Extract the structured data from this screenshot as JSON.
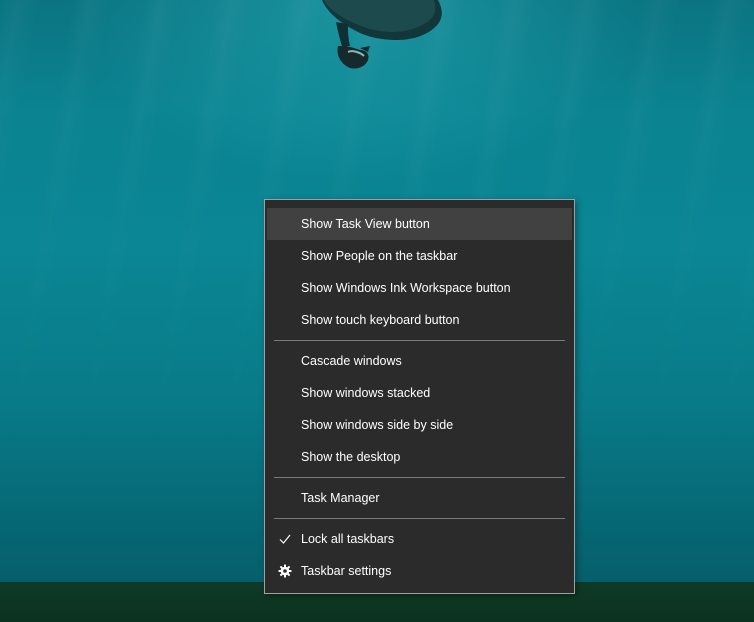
{
  "desktop": {
    "wallpaper": "underwater-swimmer",
    "water_color": "#0a8694",
    "taskbar_color": "#0e3b26"
  },
  "context_menu": {
    "background": "#2b2b2b",
    "highlight": "#414141",
    "groups": [
      {
        "items": [
          {
            "label": "Show Task View button",
            "highlighted": true
          },
          {
            "label": "Show People on the taskbar"
          },
          {
            "label": "Show Windows Ink Workspace button"
          },
          {
            "label": "Show touch keyboard button"
          }
        ]
      },
      {
        "items": [
          {
            "label": "Cascade windows"
          },
          {
            "label": "Show windows stacked"
          },
          {
            "label": "Show windows side by side"
          },
          {
            "label": "Show the desktop"
          }
        ]
      },
      {
        "items": [
          {
            "label": "Task Manager"
          }
        ]
      },
      {
        "items": [
          {
            "label": "Lock all taskbars",
            "icon": "checkmark-icon",
            "checked": true
          },
          {
            "label": "Taskbar settings",
            "icon": "gear-icon"
          }
        ]
      }
    ]
  }
}
